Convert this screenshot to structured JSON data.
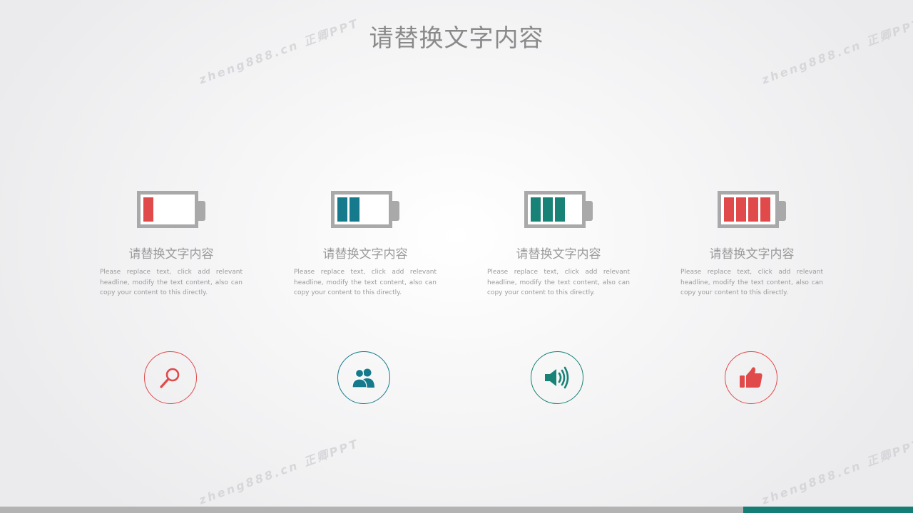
{
  "title": "请替换文字内容",
  "watermark": "zheng888.cn 正卿PPT",
  "cards": [
    {
      "title": "请替换文字内容",
      "description": "Please replace text, click add relevant headline, modify the text content, also can copy your content to this directly.",
      "battery_level": 0.25,
      "color": "#e14a4a",
      "icon": "magnifier-icon"
    },
    {
      "title": "请替换文字内容",
      "description": "Please replace text, click add relevant headline, modify the text content, also can copy your content to this directly.",
      "battery_level": 0.5,
      "color": "#157b8c",
      "icon": "users-icon"
    },
    {
      "title": "请替换文字内容",
      "description": "Please replace text, click add relevant headline, modify the text content, also can copy your content to this directly.",
      "battery_level": 0.75,
      "color": "#188276",
      "icon": "speaker-icon"
    },
    {
      "title": "请替换文字内容",
      "description": "Please replace text, click add relevant headline, modify the text content, also can copy your content to this directly.",
      "battery_level": 1.0,
      "color": "#e14a4a",
      "icon": "thumbs-up-icon"
    }
  ],
  "footer": {
    "bar_color": "#b3b3b3",
    "accent_color": "#157d75"
  }
}
